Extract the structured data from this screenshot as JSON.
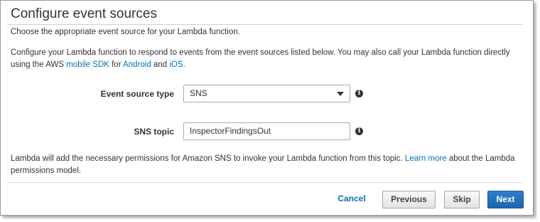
{
  "page": {
    "title": "Configure event sources",
    "subtitle": "Choose the appropriate event source for your Lambda function."
  },
  "description": {
    "text_1": "Configure your Lambda function to respond to events from the event sources listed below. You may also call your Lambda function directly using the AWS ",
    "link_mobile_sdk": "mobile SDK",
    "text_2": " for ",
    "link_android": "Android",
    "text_3": " and ",
    "link_ios": "iOS",
    "text_4": "."
  },
  "form": {
    "event_source_type": {
      "label": "Event source type",
      "value": "SNS"
    },
    "sns_topic": {
      "label": "SNS topic",
      "value": "InspectorFindingsOut"
    },
    "info_icon_glyph": "i"
  },
  "footer_note": {
    "text_1": "Lambda will add the necessary permissions for Amazon SNS to invoke your Lambda function from this topic. ",
    "link_learn_more": "Learn more",
    "text_2": " about the Lambda permissions model."
  },
  "buttons": {
    "cancel": "Cancel",
    "previous": "Previous",
    "skip": "Skip",
    "next": "Next"
  },
  "colors": {
    "link": "#0073bb",
    "primary_button": "#1e66ad",
    "text": "#333333"
  }
}
